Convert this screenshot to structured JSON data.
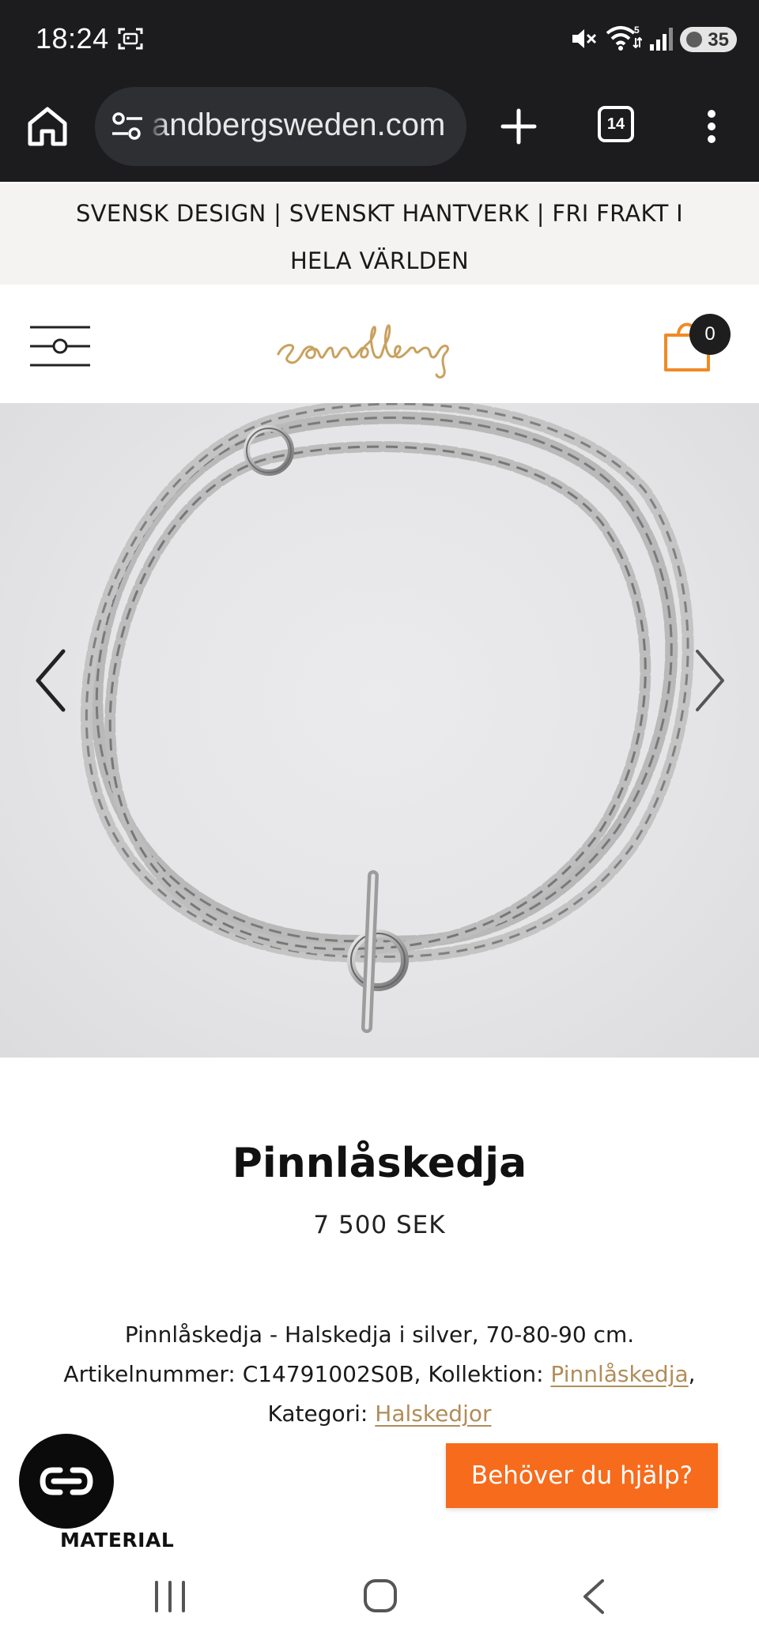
{
  "status_bar": {
    "time": "18:24",
    "battery": "35",
    "wifi_badge": "5",
    "icons": [
      "screenshot-icon",
      "mute-icon",
      "wifi-icon",
      "signal-icon",
      "battery-icon"
    ]
  },
  "browser": {
    "url": "andbergsweden.com",
    "tab_count": "14",
    "icons": [
      "home-icon",
      "tune-icon",
      "plus-icon",
      "tabs-icon",
      "more-vert-icon"
    ]
  },
  "announcement": "SVENSK DESIGN | SVENSKT HANTVERK | FRI FRAKT I HELA VÄRLDEN",
  "header": {
    "logo_text": "sandberg",
    "cart_count": "0",
    "logo_color": "#c9a15f",
    "cart_color": "#f08a24"
  },
  "product": {
    "title": "Pinnlåskedja",
    "price": "7 500 SEK",
    "description": {
      "intro": "Pinnlåskedja - Halskedja i silver, 70-80-90 cm. Artikelnummer: C14791002S0B, Kollektion: ",
      "collection_link": "Pinnlåskedja",
      "category_label": ", Kategori: ",
      "category_link": "Halskedjor"
    },
    "material_heading": "MATERIAL"
  },
  "help_button": "Behöver du hjälp?",
  "colors": {
    "help_button": "#f76b1c",
    "link": "#b08d5a",
    "chrome": "#1c1c1e"
  }
}
